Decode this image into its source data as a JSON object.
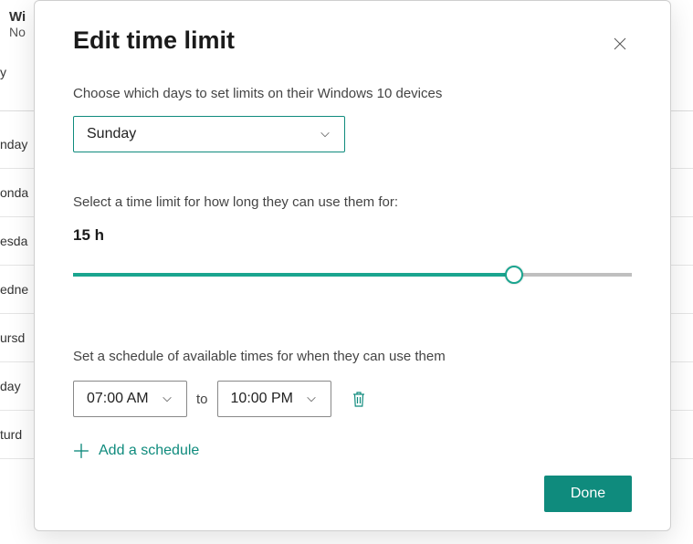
{
  "background": {
    "title": "Wi",
    "subtitle": "No",
    "left_col_letter": "y",
    "days": [
      "nday",
      "onda",
      "esda",
      "edne",
      "ursd",
      "day",
      "turd"
    ]
  },
  "modal": {
    "title": "Edit time limit",
    "choose_days_label": "Choose which days to set limits on their Windows 10 devices",
    "selected_day": "Sunday",
    "time_limit_label": "Select a time limit for how long they can use them for:",
    "slider": {
      "value_label": "15 h",
      "value": 15,
      "max": 19,
      "percent": 79
    },
    "schedule_label": "Set a schedule of available times for when they can use them",
    "schedule": {
      "from": "07:00 AM",
      "to_label": "to",
      "to": "10:00 PM"
    },
    "add_schedule_label": "Add a schedule",
    "done_label": "Done"
  }
}
